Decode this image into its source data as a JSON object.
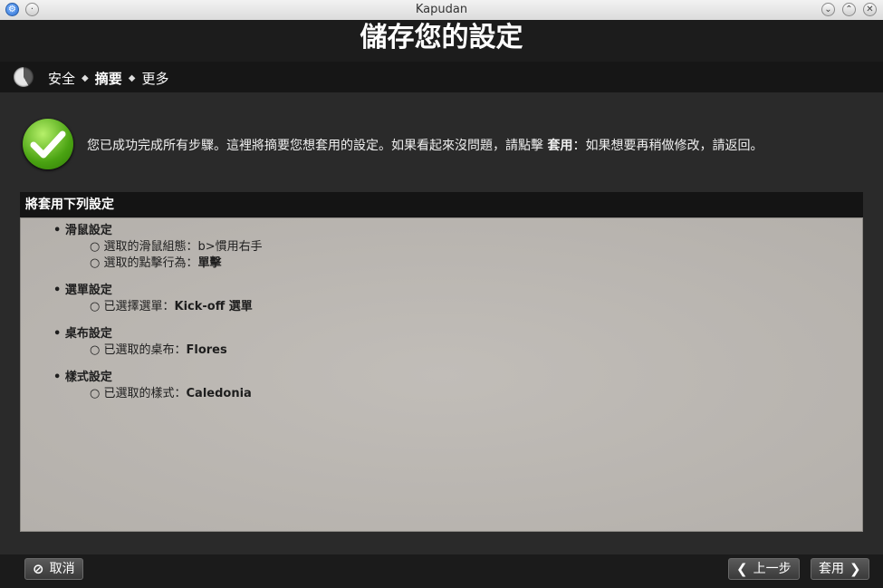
{
  "window": {
    "title": "Kapudan"
  },
  "heading": "儲存您的設定",
  "breadcrumb": {
    "items": [
      "安全",
      "摘要",
      "更多"
    ],
    "arrow": "◆"
  },
  "message": {
    "pre": "您已成功完成所有步驟。這裡將摘要您想套用的設定。如果看起來沒問題，請點擊 ",
    "bold": "套用",
    "post": "：如果想要再稍做修改，請返回。"
  },
  "panel": {
    "title": "將套用下列設定",
    "groups": [
      {
        "title": "滑鼠設定",
        "items": [
          {
            "label": "選取的滑鼠組態：",
            "value": "b>慣用右手"
          },
          {
            "label": "選取的點擊行為：",
            "value": "單擊"
          }
        ]
      },
      {
        "title": "選單設定",
        "items": [
          {
            "label": "已選擇選單：",
            "value": "Kick-off 選單"
          }
        ]
      },
      {
        "title": "桌布設定",
        "items": [
          {
            "label": "已選取的桌布：",
            "value": "Flores"
          }
        ]
      },
      {
        "title": "樣式設定",
        "items": [
          {
            "label": "已選取的樣式：",
            "value": "Caledonia"
          }
        ]
      }
    ]
  },
  "footer": {
    "cancel": "取消",
    "back": "上一步",
    "apply": "套用"
  },
  "icons": {
    "app": "app-icon",
    "menu": "window-menu-icon",
    "minimize": "minimize-icon",
    "maximize": "maximize-icon",
    "close": "close-icon",
    "progress": "progress-pie-icon",
    "success": "checkmark-icon",
    "cancel": "cancel-icon",
    "back": "chevron-left-icon",
    "apply": "chevron-right-icon"
  },
  "colors": {
    "success": "#4aa312",
    "background": "#2a2a2a",
    "panel": "#b8b4af"
  }
}
